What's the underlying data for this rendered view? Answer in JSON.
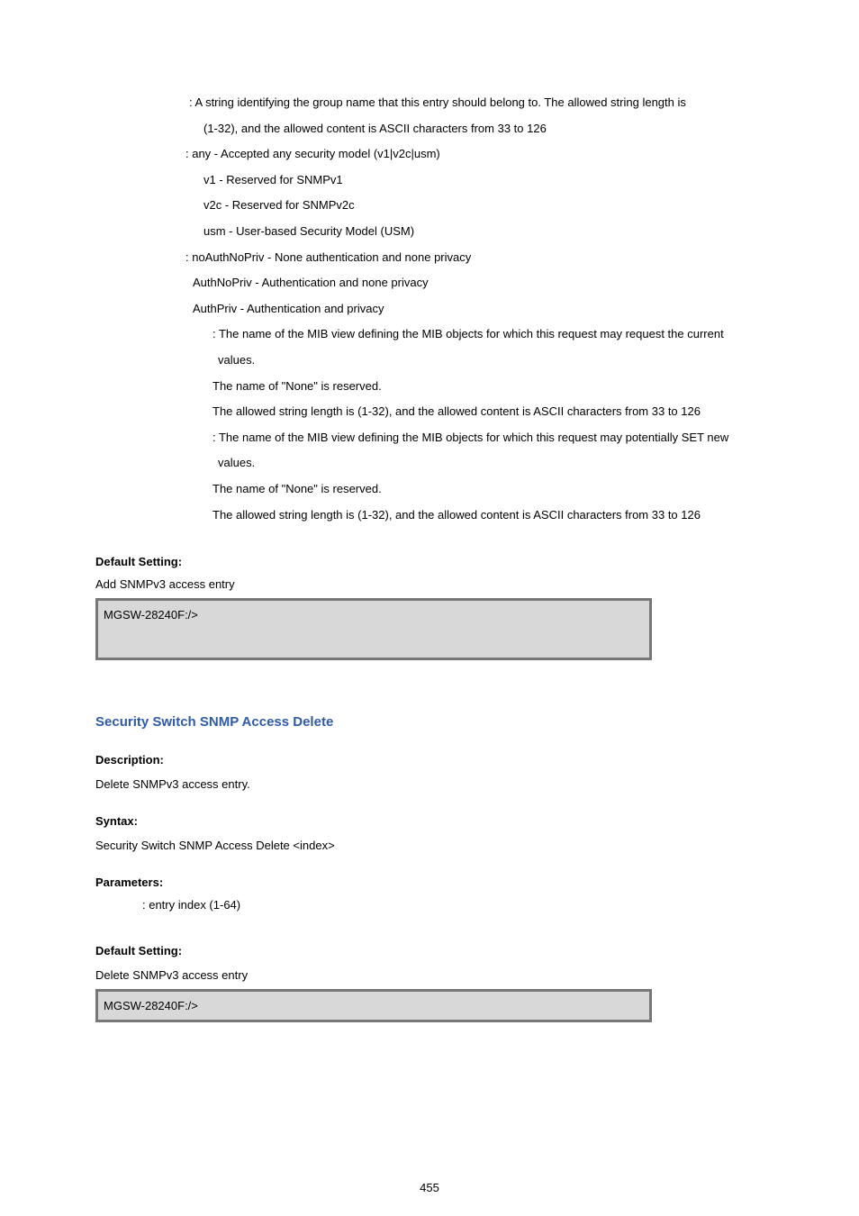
{
  "params": {
    "group_name_line1": ": A string identifying the group name that this entry should belong to. The allowed string length is",
    "group_name_line2": "(1-32), and the allowed content is ASCII characters from 33 to 126",
    "sec_model_any": ": any - Accepted any security model (v1|v2c|usm)",
    "sec_model_v1": "v1    - Reserved for SNMPv1",
    "sec_model_v2c": "v2c - Reserved for SNMPv2c",
    "sec_model_usm": "usm - User-based Security Model (USM)",
    "sec_level_noauth": ": noAuthNoPriv - None authentication and none privacy",
    "sec_level_authnopriv": "AuthNoPriv     - Authentication and none privacy",
    "sec_level_authpriv": "AuthPriv         - Authentication and privacy",
    "read_view_line1": ": The name of the MIB view defining the MIB objects for which this request may request the current",
    "read_view_line2": "values.",
    "read_view_line3": "The name of \"None\" is reserved.",
    "read_view_line4": "The allowed string length is (1-32), and the allowed content is ASCII characters from 33 to 126",
    "write_view_line1": ": The name of the MIB view defining the MIB objects for which this request may potentially SET new",
    "write_view_line2": "values.",
    "write_view_line3": "The name of \"None\" is reserved.",
    "write_view_line4": "The allowed string length is (1-32), and the allowed content is ASCII characters from 33 to 126"
  },
  "add": {
    "default_label": "Default Setting:",
    "default_text": "Add SNMPv3 access entry",
    "code": "MGSW-28240F:/>"
  },
  "delete_section": {
    "title": "Security Switch SNMP Access Delete",
    "desc_label": "Description:",
    "desc_text": "Delete SNMPv3 access entry.",
    "syntax_label": "Syntax:",
    "syntax_text": "Security Switch SNMP Access Delete <index>",
    "param_label": "Parameters:",
    "param_text": ": entry index (1-64)",
    "default_label": "Default Setting:",
    "default_text": "Delete SNMPv3 access entry",
    "code": "MGSW-28240F:/>"
  },
  "page_number": "455"
}
